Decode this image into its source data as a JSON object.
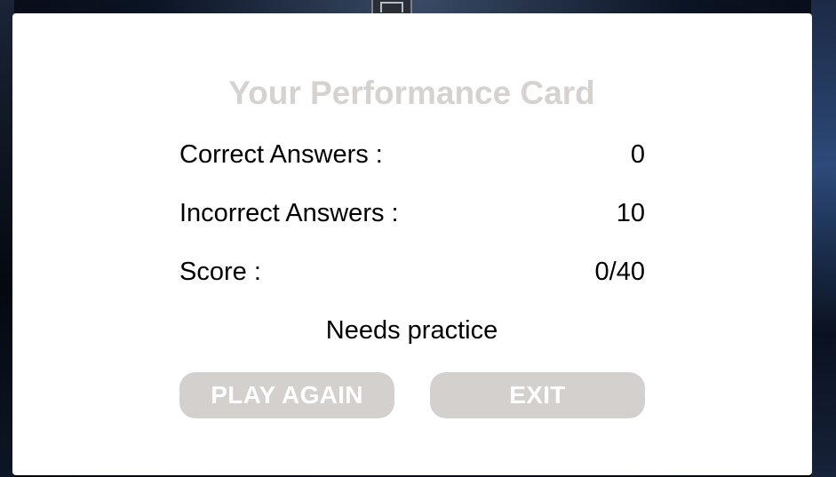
{
  "card": {
    "title": "Your Performance Card",
    "stats": {
      "correct_label": "Correct Answers :",
      "correct_value": "0",
      "incorrect_label": "Incorrect Answers :",
      "incorrect_value": "10",
      "score_label": "Score :",
      "score_value": "0/40"
    },
    "feedback": "Needs practice",
    "buttons": {
      "play_again": "PLAY AGAIN",
      "exit": "EXIT"
    }
  },
  "colors": {
    "title": "#d6d2cf",
    "button_bg": "#d3d0cd",
    "button_text": "#ffffff",
    "card_bg": "#ffffff"
  }
}
